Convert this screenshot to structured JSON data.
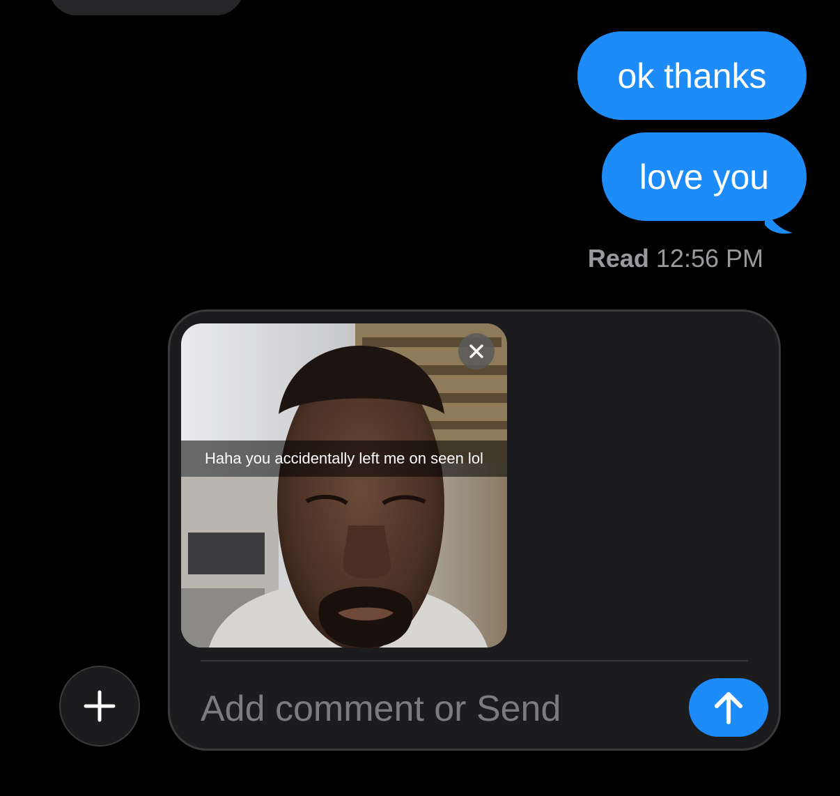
{
  "colors": {
    "background": "#000000",
    "outgoing_bubble": "#1e8cf8",
    "send_button": "#1e8cf8",
    "composer_background": "#1c1c1e",
    "secondary_text": "#9a9a9e"
  },
  "messages": [
    {
      "direction": "outgoing",
      "text": "ok thanks"
    },
    {
      "direction": "outgoing",
      "text": "love you"
    }
  ],
  "receipt": {
    "status": "Read",
    "time": "12:56 PM"
  },
  "composer": {
    "placeholder": "Add comment or Send",
    "attachment": {
      "caption": "Haha you accidentally left me on seen lol",
      "remove_icon": "close-icon"
    },
    "add_icon": "plus-icon",
    "send_icon": "arrow-up-icon"
  }
}
